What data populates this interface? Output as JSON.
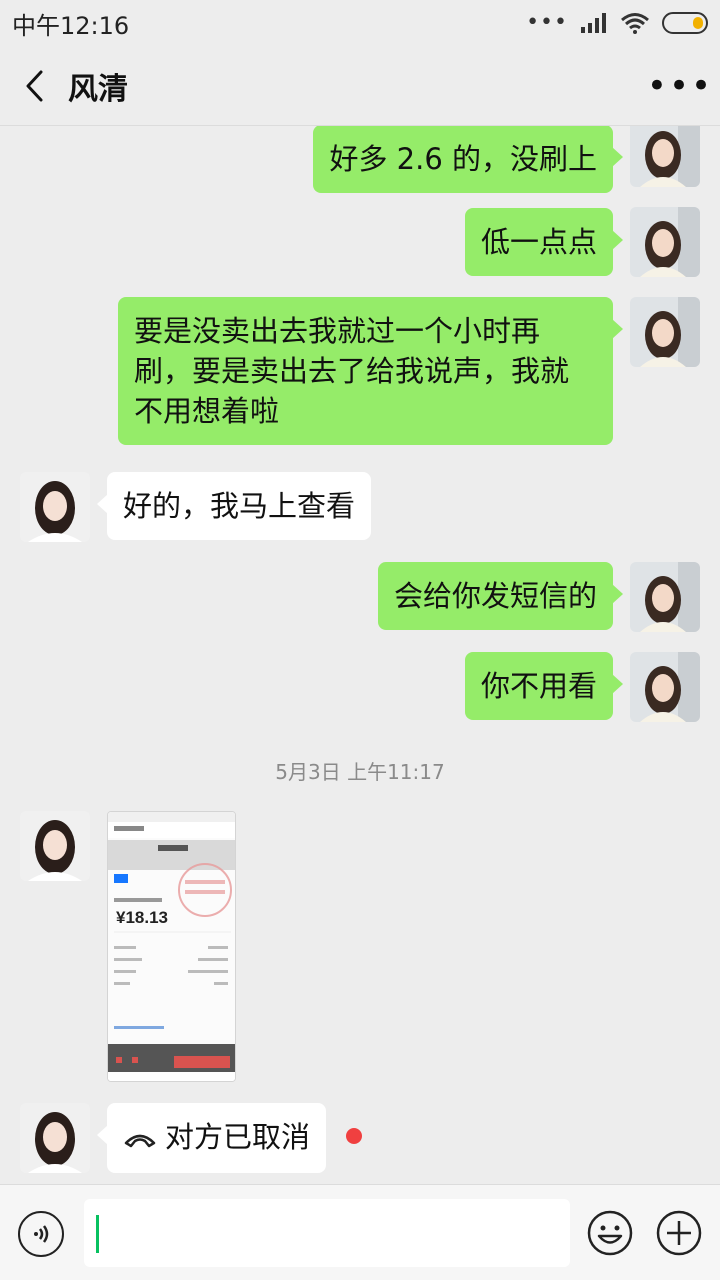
{
  "status_bar": {
    "time": "中午12:16",
    "signal": "signal-icon",
    "wifi": "wifi-icon",
    "battery": "battery-icon"
  },
  "header": {
    "title": "风清",
    "back_icon": "chevron-left-icon",
    "more_icon": "more-dots-icon"
  },
  "messages": [
    {
      "side": "right",
      "text": "好多 2.6 的，没刷上"
    },
    {
      "side": "right",
      "text": "低一点点"
    },
    {
      "side": "right",
      "text": "要是没卖出去我就过一个小时再刷，要是卖出去了给我说声，我就不用想着啦"
    },
    {
      "side": "left",
      "text": "好的，我马上查看"
    },
    {
      "side": "right",
      "text": "会给你发短信的"
    },
    {
      "side": "right",
      "text": "你不用看"
    }
  ],
  "timestamp": "5月3日 上午11:17",
  "image_message": {
    "amount": "¥18.13",
    "stamp_text": "支付宝（中国）网络技术有限公司"
  },
  "call_message": {
    "text": "对方已取消",
    "icon": "phone-hangup-icon"
  },
  "input_bar": {
    "voice_icon": "voice-icon",
    "emoji_icon": "emoji-icon",
    "plus_icon": "plus-icon",
    "value": ""
  },
  "colors": {
    "my_bubble": "#95ec69",
    "other_bubble": "#ffffff",
    "background": "#ededed",
    "caret": "#07c160",
    "unread_dot": "#f04040"
  }
}
